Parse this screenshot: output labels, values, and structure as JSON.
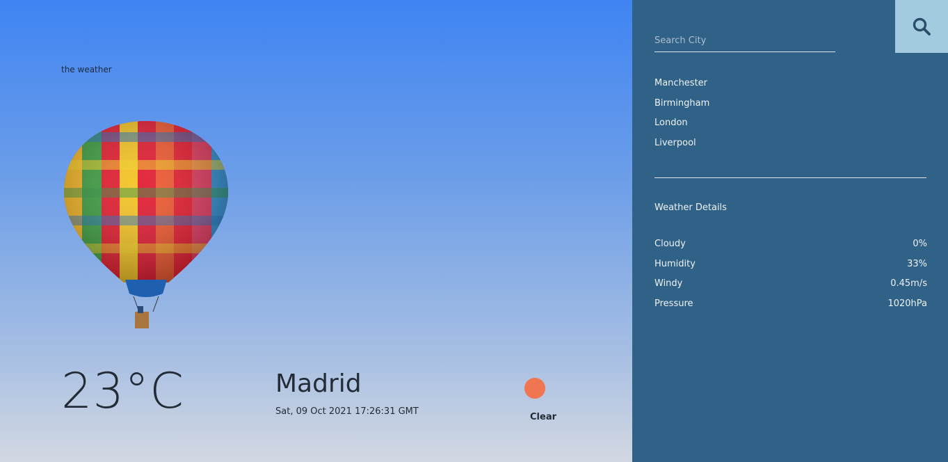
{
  "app": {
    "brand": "the weather"
  },
  "current": {
    "temperature": "23°C",
    "city": "Madrid",
    "datetime": "Sat, 09 Oct 2021 17:26:31 GMT",
    "condition": "Clear",
    "condition_icon": "sun-icon",
    "condition_color": "#ef7651"
  },
  "sidebar": {
    "search": {
      "placeholder": "Search City",
      "value": "",
      "button_icon": "search-icon"
    },
    "cities": [
      "Manchester",
      "Birmingham",
      "London",
      "Liverpool"
    ],
    "details_title": "Weather Details",
    "details": [
      {
        "label": "Cloudy",
        "value": "0%"
      },
      {
        "label": "Humidity",
        "value": "33%"
      },
      {
        "label": "Windy",
        "value": "0.45m/s"
      },
      {
        "label": "Pressure",
        "value": "1020hPa"
      }
    ]
  },
  "colors": {
    "panel_bg": "#306186",
    "search_button_bg": "#a3cbe0",
    "sky_top": "#3f84f3",
    "sky_bottom": "#d2d8e2"
  }
}
